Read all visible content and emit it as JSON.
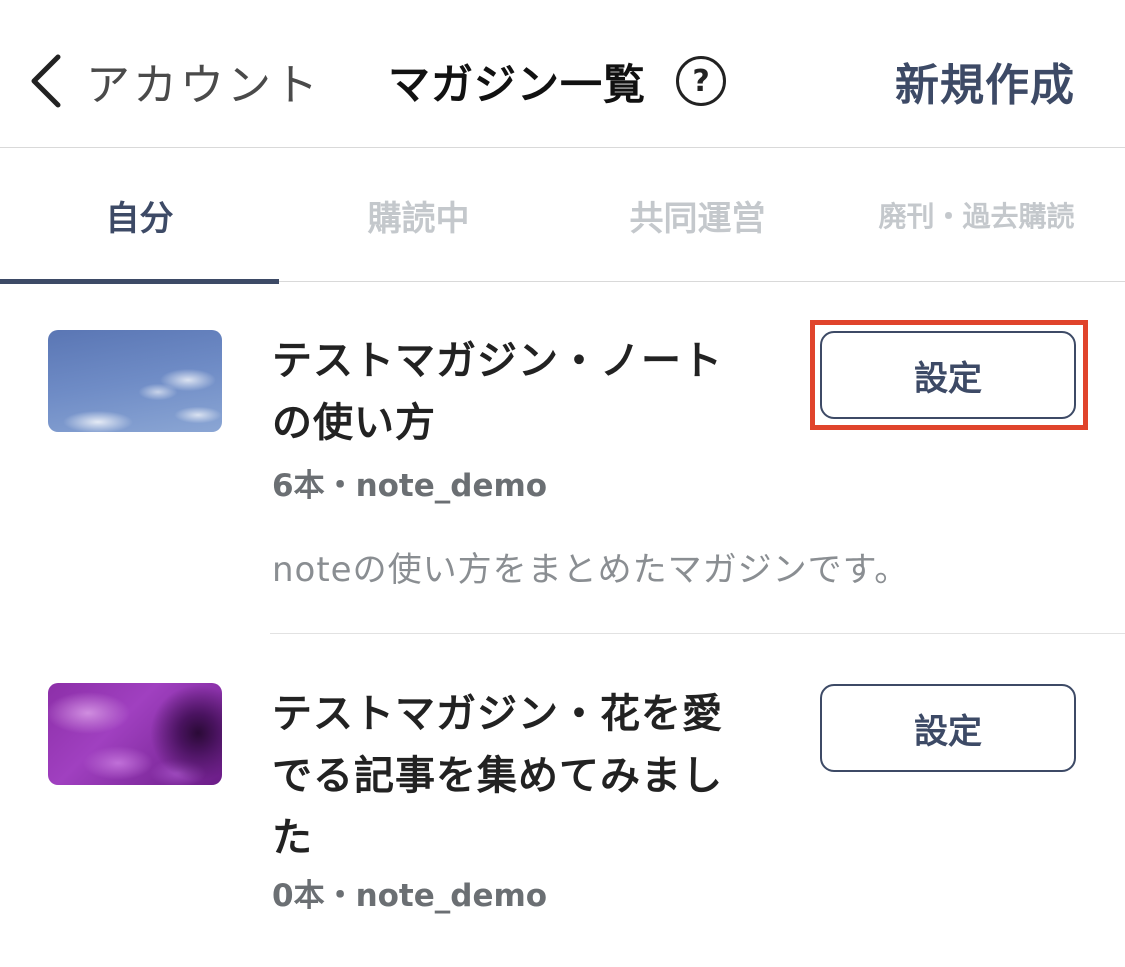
{
  "header": {
    "back_label": "アカウント",
    "title": "マガジン一覧",
    "help_icon": "?",
    "new_label": "新規作成"
  },
  "tabs": [
    {
      "label": "自分",
      "active": true
    },
    {
      "label": "購読中",
      "active": false
    },
    {
      "label": "共同運営",
      "active": false
    },
    {
      "label": "廃刊・過去購読",
      "active": false
    }
  ],
  "magazines": [
    {
      "title_line1": "テストマガジン・ノート",
      "title_line2": "の使い方",
      "meta": "6本・note_demo",
      "description": "noteの使い方をまとめたマガジンです。",
      "button_label": "設定",
      "thumbnail": "sky-image"
    },
    {
      "title_line1": "テストマガジン・花を愛",
      "title_line2": "でる記事を集めてみまし",
      "title_line3": "た",
      "meta": "0本・note_demo",
      "button_label": "設定",
      "thumbnail": "flower-image"
    }
  ],
  "colors": {
    "accent": "#3d4a66",
    "highlight": "#e0442c",
    "inactive_tab": "#c4c8cc"
  }
}
